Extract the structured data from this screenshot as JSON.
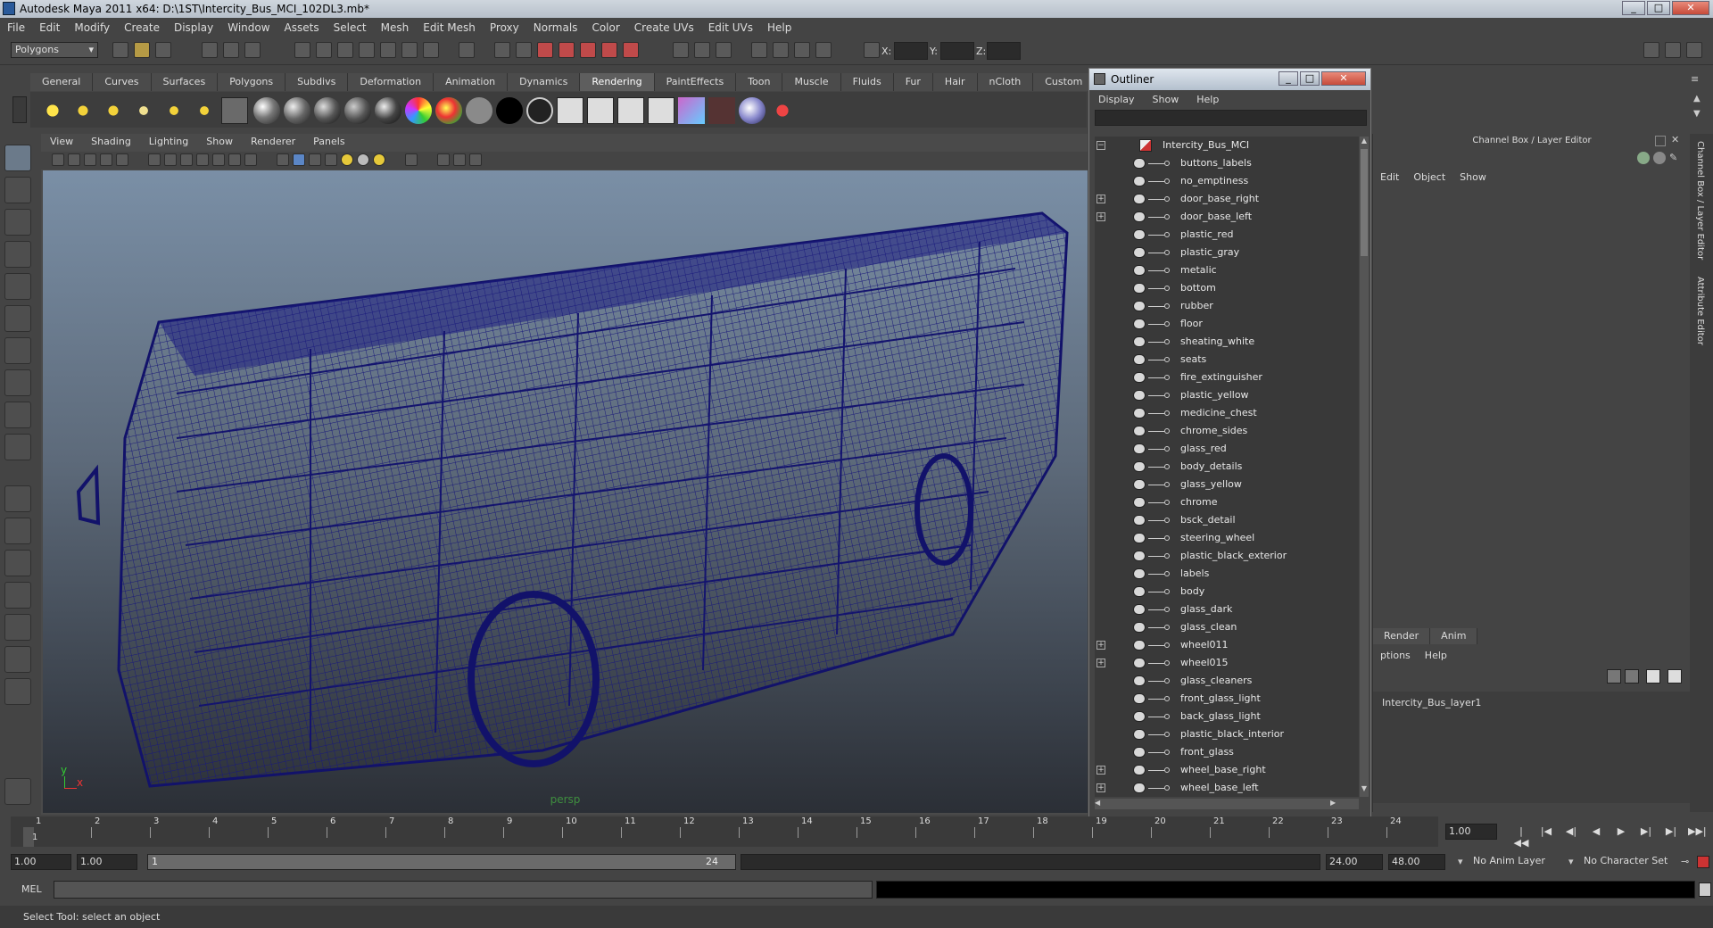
{
  "window": {
    "title": "Autodesk Maya 2011 x64: D:\\1ST\\Intercity_Bus_MCI_102DL3.mb*"
  },
  "menubar": [
    "File",
    "Edit",
    "Modify",
    "Create",
    "Display",
    "Window",
    "Assets",
    "Select",
    "Mesh",
    "Edit Mesh",
    "Proxy",
    "Normals",
    "Color",
    "Create UVs",
    "Edit UVs",
    "Help"
  ],
  "statusline": {
    "mode": "Polygons",
    "x_label": "X:",
    "y_label": "Y:",
    "z_label": "Z:"
  },
  "shelf_tabs": [
    "General",
    "Curves",
    "Surfaces",
    "Polygons",
    "Subdivs",
    "Deformation",
    "Animation",
    "Dynamics",
    "Rendering",
    "PaintEffects",
    "Toon",
    "Muscle",
    "Fluids",
    "Fur",
    "Hair",
    "nCloth",
    "Custom"
  ],
  "active_shelf_tab": "Rendering",
  "viewport": {
    "menu": [
      "View",
      "Shading",
      "Lighting",
      "Show",
      "Renderer",
      "Panels"
    ],
    "camera_label": "persp",
    "axis_y": "y",
    "axis_x": "x",
    "wire_color": "#1a1a7a"
  },
  "outliner": {
    "title": "Outliner",
    "menu": [
      "Display",
      "Show",
      "Help"
    ],
    "root": "Intercity_Bus_MCI",
    "items": [
      {
        "label": "buttons_labels",
        "expandable": false
      },
      {
        "label": "no_emptiness",
        "expandable": false
      },
      {
        "label": "door_base_right",
        "expandable": true
      },
      {
        "label": "door_base_left",
        "expandable": true
      },
      {
        "label": "plastic_red",
        "expandable": false
      },
      {
        "label": "plastic_gray",
        "expandable": false
      },
      {
        "label": "metalic",
        "expandable": false
      },
      {
        "label": "bottom",
        "expandable": false
      },
      {
        "label": "rubber",
        "expandable": false
      },
      {
        "label": "floor",
        "expandable": false
      },
      {
        "label": "sheating_white",
        "expandable": false
      },
      {
        "label": "seats",
        "expandable": false
      },
      {
        "label": "fire_extinguisher",
        "expandable": false
      },
      {
        "label": "plastic_yellow",
        "expandable": false
      },
      {
        "label": "medicine_chest",
        "expandable": false
      },
      {
        "label": "chrome_sides",
        "expandable": false
      },
      {
        "label": "glass_red",
        "expandable": false
      },
      {
        "label": "body_details",
        "expandable": false
      },
      {
        "label": "glass_yellow",
        "expandable": false
      },
      {
        "label": "chrome",
        "expandable": false
      },
      {
        "label": "bsck_detail",
        "expandable": false
      },
      {
        "label": "steering_wheel",
        "expandable": false
      },
      {
        "label": "plastic_black_exterior",
        "expandable": false
      },
      {
        "label": "labels",
        "expandable": false
      },
      {
        "label": "body",
        "expandable": false
      },
      {
        "label": "glass_dark",
        "expandable": false
      },
      {
        "label": "glass_clean",
        "expandable": false
      },
      {
        "label": "wheel011",
        "expandable": true
      },
      {
        "label": "wheel015",
        "expandable": true
      },
      {
        "label": "glass_cleaners",
        "expandable": false
      },
      {
        "label": "front_glass_light",
        "expandable": false
      },
      {
        "label": "back_glass_light",
        "expandable": false
      },
      {
        "label": "plastic_black_interior",
        "expandable": false
      },
      {
        "label": "front_glass",
        "expandable": false
      },
      {
        "label": "wheel_base_right",
        "expandable": true
      },
      {
        "label": "wheel_base_left",
        "expandable": true
      }
    ]
  },
  "channel_box": {
    "title": "Channel Box / Layer Editor",
    "menu": [
      "Edit",
      "Object",
      "Show"
    ],
    "layer_tabs": [
      "Render",
      "Anim"
    ],
    "layer_menu": [
      "ptions",
      "Help"
    ],
    "layer_name": "Intercity_Bus_layer1",
    "side_tab_1": "Channel Box / Layer Editor",
    "side_tab_2": "Attribute Editor"
  },
  "timeline": {
    "ticks": [
      "1",
      "2",
      "3",
      "4",
      "5",
      "6",
      "7",
      "8",
      "9",
      "10",
      "11",
      "12",
      "13",
      "14",
      "15",
      "16",
      "17",
      "18",
      "19",
      "20",
      "21",
      "22",
      "23",
      "24"
    ],
    "current_frame": "1",
    "current_time_field": "1.00"
  },
  "range": {
    "start": "1.00",
    "playback_start": "1.00",
    "slider_start": "1",
    "slider_end": "24",
    "playback_end": "24.00",
    "end": "48.00",
    "anim_layer": "No Anim Layer",
    "character_set": "No Character Set"
  },
  "command_line": {
    "label": "MEL"
  },
  "help_line": "Select Tool: select an object"
}
